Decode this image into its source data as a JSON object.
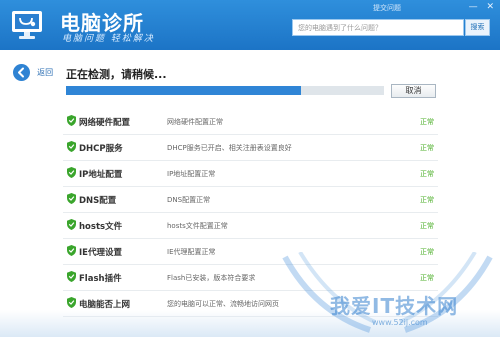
{
  "app": {
    "title": "电脑诊所",
    "slogan": "电脑问题 轻松解决",
    "feedback": "提交问题",
    "window_controls": [
      "—",
      "✕"
    ]
  },
  "search": {
    "placeholder": "您的电脑遇到了什么问题？",
    "button": "搜索"
  },
  "nav": {
    "back_label": "返回"
  },
  "scan": {
    "status_title": "正在检测，请稍候...",
    "progress": 0.74,
    "cancel_label": "取消"
  },
  "checks": [
    {
      "name": "网络硬件配置",
      "desc": "网络硬件配置正常",
      "status": "正常"
    },
    {
      "name": "DHCP服务",
      "desc": "DHCP服务已开启、相关注册表设置良好",
      "status": "正常"
    },
    {
      "name": "IP地址配置",
      "desc": "IP地址配置正常",
      "status": "正常"
    },
    {
      "name": "DNS配置",
      "desc": "DNS配置正常",
      "status": "正常"
    },
    {
      "name": "hosts文件",
      "desc": "hosts文件配置正常",
      "status": "正常"
    },
    {
      "name": "IE代理设置",
      "desc": "IE代理配置正常",
      "status": "正常"
    },
    {
      "name": "Flash插件",
      "desc": "Flash已安装，版本符合要求",
      "status": "正常"
    },
    {
      "name": "电脑能否上网",
      "desc": "您的电脑可以正常、流畅地访问网页",
      "status": ""
    }
  ],
  "watermark": {
    "text": "我爱IT技术网",
    "url": "www.52ij.com"
  },
  "colors": {
    "header_blue": "#1c74c6",
    "progress_blue": "#2f85d6",
    "ok_green": "#4caf2a",
    "shield_green": "#3aa52c"
  },
  "icons": [
    "monitor-stethoscope-logo",
    "back-arrow-icon",
    "shield-check-icon"
  ]
}
